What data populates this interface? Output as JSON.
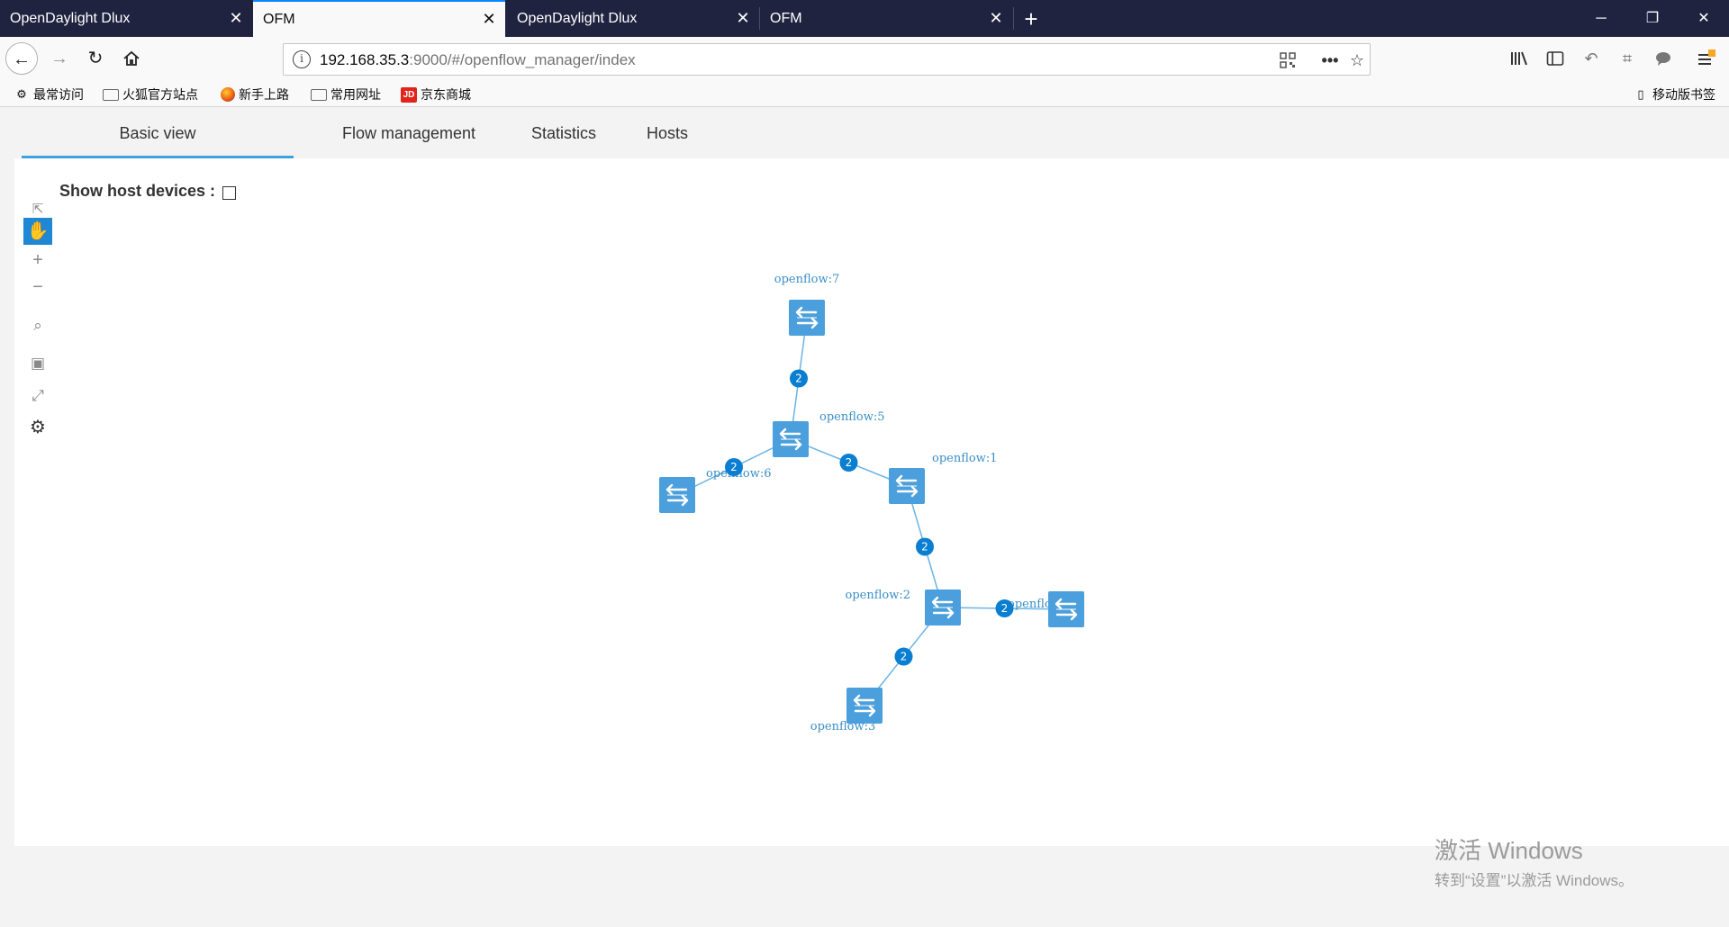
{
  "tabs": [
    {
      "title": "OpenDaylight Dlux",
      "active": false
    },
    {
      "title": "OFM",
      "active": true
    },
    {
      "title": "OpenDaylight Dlux",
      "active": false
    },
    {
      "title": "OFM",
      "active": false
    }
  ],
  "window_controls": {
    "minimize": "─",
    "restore": "❐",
    "close": "✕"
  },
  "nav": {
    "url_host": "192.168.35.3",
    "url_rest": ":9000/#/openflow_manager/index"
  },
  "bookmarks": [
    {
      "label": "最常访问",
      "icon": "gear-icon"
    },
    {
      "label": "火狐官方站点",
      "icon": "folder-icon"
    },
    {
      "label": "新手上路",
      "icon": "firefox-icon"
    },
    {
      "label": "常用网址",
      "icon": "folder-icon"
    },
    {
      "label": "京东商城",
      "icon": "jd-icon",
      "icon_text": "JD"
    }
  ],
  "mobile_bookmarks": "移动版书签",
  "page_tabs": [
    {
      "label": "Basic view",
      "active": true
    },
    {
      "label": "Flow management",
      "active": false
    },
    {
      "label": "Statistics",
      "active": false
    },
    {
      "label": "Hosts",
      "active": false
    }
  ],
  "show_host_devices": {
    "label": "Show host devices :",
    "checked": false
  },
  "topology": {
    "node_color": "#4a9fdc",
    "badge_color": "#0a7fd1",
    "link_color": "#6bb3e6",
    "nodes": [
      {
        "id": "openflow:7",
        "label": "openflow:7"
      },
      {
        "id": "openflow:5",
        "label": "openflow:5"
      },
      {
        "id": "openflow:6",
        "label": "openflow:6"
      },
      {
        "id": "openflow:1",
        "label": "openflow:1"
      },
      {
        "id": "openflow:2",
        "label": "openflow:2"
      },
      {
        "id": "openflow:4",
        "label": "openflow:4"
      },
      {
        "id": "openflow:3",
        "label": "openflow:3"
      }
    ],
    "links": [
      {
        "source": "openflow:7",
        "target": "openflow:5",
        "count": "2"
      },
      {
        "source": "openflow:5",
        "target": "openflow:6",
        "count": "2"
      },
      {
        "source": "openflow:5",
        "target": "openflow:1",
        "count": "2"
      },
      {
        "source": "openflow:1",
        "target": "openflow:2",
        "count": "2"
      },
      {
        "source": "openflow:2",
        "target": "openflow:4",
        "count": "2"
      },
      {
        "source": "openflow:2",
        "target": "openflow:3",
        "count": "2"
      }
    ]
  },
  "watermark": {
    "line1": "激活 Windows",
    "line2": "转到“设置”以激活 Windows。"
  }
}
